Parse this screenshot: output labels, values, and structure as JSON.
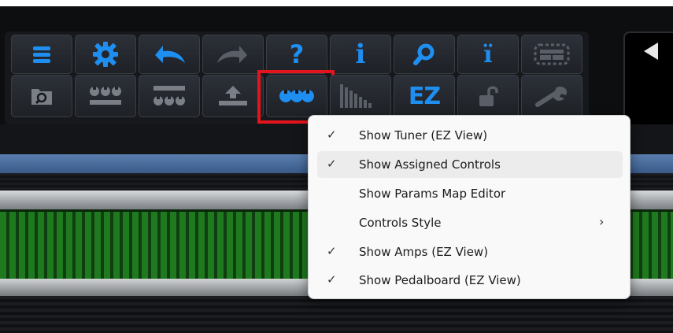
{
  "toolbar": {
    "row1": [
      {
        "name": "menu-button",
        "icon": "hamburger-icon"
      },
      {
        "name": "settings-button",
        "icon": "gear-icon"
      },
      {
        "name": "undo-button",
        "icon": "undo-icon"
      },
      {
        "name": "redo-button",
        "icon": "redo-icon"
      },
      {
        "name": "help-button",
        "icon": "question-mark-icon",
        "label": "?"
      },
      {
        "name": "info-button",
        "icon": "info-icon",
        "label": "i"
      },
      {
        "name": "search-button",
        "icon": "magnifier-icon"
      },
      {
        "name": "info-detail-button",
        "icon": "info-double-icon",
        "label": "ï"
      },
      {
        "name": "layout-button",
        "icon": "layout-panel-icon"
      }
    ],
    "row2": [
      {
        "name": "browser-button",
        "icon": "folder-search-icon"
      },
      {
        "name": "controls-row-button",
        "icon": "knobs-bar-icon"
      },
      {
        "name": "controls-bar-button",
        "icon": "bar-knobs-icon"
      },
      {
        "name": "export-button",
        "icon": "upload-tray-icon"
      },
      {
        "name": "assigned-controls-button",
        "icon": "three-knobs-icon"
      },
      {
        "name": "meter-button",
        "icon": "level-meter-icon"
      },
      {
        "name": "ez-view-button",
        "icon": "ez-icon",
        "label": "EZ"
      },
      {
        "name": "lock-button",
        "icon": "unlock-icon"
      },
      {
        "name": "tools-button",
        "icon": "wrench-icon"
      }
    ],
    "accent_color": "#1e8ef0",
    "highlight_color": "#e4141c"
  },
  "context_menu": {
    "items": [
      {
        "label": "Show Tuner (EZ View)",
        "checked": true,
        "submenu": false
      },
      {
        "label": "Show Assigned Controls",
        "checked": true,
        "submenu": false,
        "hovered": true
      },
      {
        "label": "Show Params Map Editor",
        "checked": false,
        "submenu": false
      },
      {
        "label": "Controls Style",
        "checked": false,
        "submenu": true
      },
      {
        "label": "Show Amps (EZ View)",
        "checked": true,
        "submenu": false
      },
      {
        "label": "Show Pedalboard (EZ View)",
        "checked": true,
        "submenu": false
      }
    ],
    "check_glyph": "✓",
    "submenu_glyph": "›"
  }
}
